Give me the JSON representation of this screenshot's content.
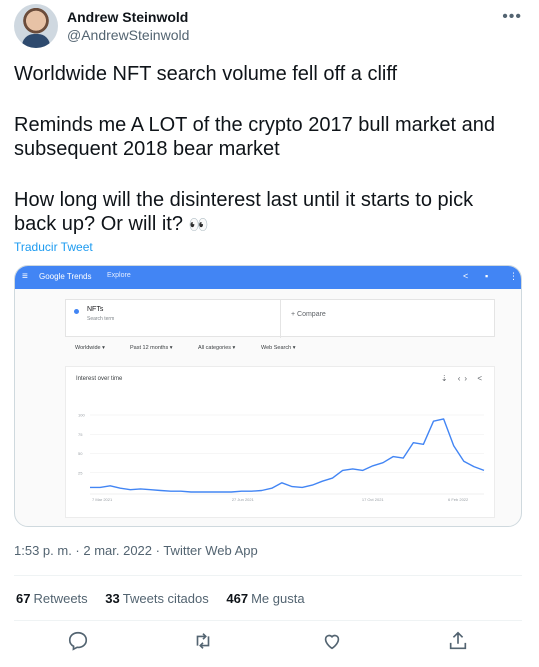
{
  "tweet": {
    "author_name": "Andrew Steinwold",
    "author_handle": "@AndrewSteinwold",
    "more_icon": "more-dots-icon",
    "text_line1": "Worldwide NFT search volume fell off a cliff",
    "text_line2a": "Reminds me A LOT of the crypto 2017 bull market and",
    "text_line2b": "subsequent 2018 bear market",
    "text_line3a": "How long will the disinterest last until it starts to pick",
    "text_line3b": "back up? Or will it?",
    "emoji": "👀",
    "translate_label": "Traducir Tweet",
    "timestamp": "1:53 p. m. · 2 mar. 2022 · Twitter Web App"
  },
  "embed": {
    "app_name": "Google Trends",
    "nav_label": "Explore",
    "search_term": "NFTs",
    "search_term_sub": "Search term",
    "compare_label": "+ Compare",
    "filters": [
      "Worldwide ▾",
      "Past 12 months ▾",
      "All categories ▾",
      "Web Search ▾"
    ],
    "chart_title": "Interest over time",
    "accent": "#4285f4"
  },
  "stats": {
    "retweets_count": "67",
    "retweets_label": "Retweets",
    "quotes_count": "33",
    "quotes_label": "Tweets citados",
    "likes_count": "467",
    "likes_label": "Me gusta"
  },
  "actions": [
    "reply-icon",
    "retweet-icon",
    "like-icon",
    "share-icon"
  ],
  "chart_data": {
    "type": "line",
    "title": "Interest over time",
    "y_ticks": [
      "100",
      "75",
      "50",
      "25"
    ],
    "x_ticks": [
      "7 Mar 2021",
      "27 Jun 2021",
      "17 Oct 2021",
      "6 Feb 2022"
    ],
    "ylim": [
      0,
      100
    ],
    "grid": true,
    "series": [
      {
        "color": "#4285f4",
        "values": [
          6,
          6,
          8,
          5,
          3,
          4,
          3,
          2,
          1,
          1,
          0,
          0,
          0,
          0,
          0,
          1,
          1,
          2,
          5,
          12,
          7,
          6,
          9,
          14,
          18,
          28,
          30,
          28,
          34,
          38,
          46,
          44,
          64,
          62,
          92,
          95,
          60,
          40,
          33,
          28
        ]
      }
    ]
  }
}
